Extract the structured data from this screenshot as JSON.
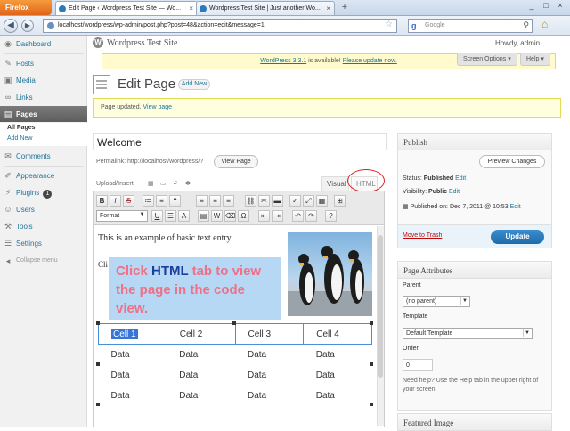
{
  "browser": {
    "menu_button": "Firefox",
    "tabs": [
      {
        "label": "Edit Page ‹ Wordpress Test Site — Wo..."
      },
      {
        "label": "Wordpress Test Site | Just another Wo..."
      }
    ],
    "new_tab": "+",
    "url": "localhost/wordpress/wp-admin/post.php?post=48&action=edit&message=1",
    "search_engine": "Google",
    "window_controls": [
      "_",
      "□",
      "×"
    ]
  },
  "wp_header": {
    "site_title": "Wordpress Test Site",
    "howdy": "Howdy, admin"
  },
  "sidebar": {
    "items": [
      {
        "label": "Dashboard",
        "icon": "dashboard-icon"
      },
      {
        "label": "Posts",
        "icon": "pin-icon"
      },
      {
        "label": "Media",
        "icon": "media-icon"
      },
      {
        "label": "Links",
        "icon": "link-icon"
      },
      {
        "label": "Pages",
        "icon": "page-icon"
      },
      {
        "label": "Comments",
        "icon": "comment-icon"
      },
      {
        "label": "Appearance",
        "icon": "brush-icon"
      },
      {
        "label": "Plugins",
        "icon": "plug-icon",
        "badge": "1"
      },
      {
        "label": "Users",
        "icon": "user-icon"
      },
      {
        "label": "Tools",
        "icon": "wrench-icon"
      },
      {
        "label": "Settings",
        "icon": "settings-icon"
      }
    ],
    "submenu": [
      "All Pages",
      "Add New"
    ],
    "collapse": "Collapse menu"
  },
  "nag": {
    "prefix": "WordPress 3.3.1",
    "middle": " is available! ",
    "link": "Please update now."
  },
  "screen_options": "Screen Options ▾",
  "help_tab": "Help ▾",
  "page": {
    "heading": "Edit Page",
    "add_new": "Add New",
    "updated_text": "Page updated. ",
    "updated_link": "View page"
  },
  "editor": {
    "title_value": "Welcome",
    "permalink": "Permalink: http://localhost/wordpress/?",
    "view_page_button": "View Page",
    "upload_insert": "Upload/Insert",
    "tab_visual": "Visual",
    "tab_html": "HTML",
    "format_select": "Format",
    "line1": "This is an example of basic text entry",
    "line2": "Cli",
    "callout": {
      "part1": "Click ",
      "keyword": "HTML",
      "part2": " tab to view the page in the code view."
    },
    "table": {
      "header": [
        "Cell 1",
        "Cell 2",
        "Cell 3",
        "Cell 4"
      ],
      "rows": [
        [
          "Data",
          "Data",
          "Data",
          "Data"
        ],
        [
          "Data",
          "Data",
          "Data",
          "Data"
        ],
        [
          "Data",
          "Data",
          "Data",
          "Data"
        ]
      ]
    }
  },
  "publish": {
    "heading": "Publish",
    "preview_button": "Preview Changes",
    "status_label": "Status: ",
    "status_value": "Published",
    "edit": "Edit",
    "visibility_label": "Visibility: ",
    "visibility_value": "Public",
    "published_on": "Published on: Dec 7, 2011 @ 10:53",
    "move_to_trash": "Move to Trash",
    "update_button": "Update"
  },
  "page_attributes": {
    "heading": "Page Attributes",
    "parent_label": "Parent",
    "parent_value": "(no parent)",
    "template_label": "Template",
    "template_value": "Default Template",
    "order_label": "Order",
    "order_value": "0",
    "help_text": "Need help? Use the Help tab in the upper right of your screen."
  },
  "featured_image": {
    "heading": "Featured Image"
  },
  "colors": {
    "link": "#21759b",
    "update_button": "#2a7fc1",
    "callout_bg": "#b6d8f4",
    "callout_text": "#f07088",
    "callout_keyword": "#1d3f9c",
    "annotation_circle": "#d22222"
  }
}
